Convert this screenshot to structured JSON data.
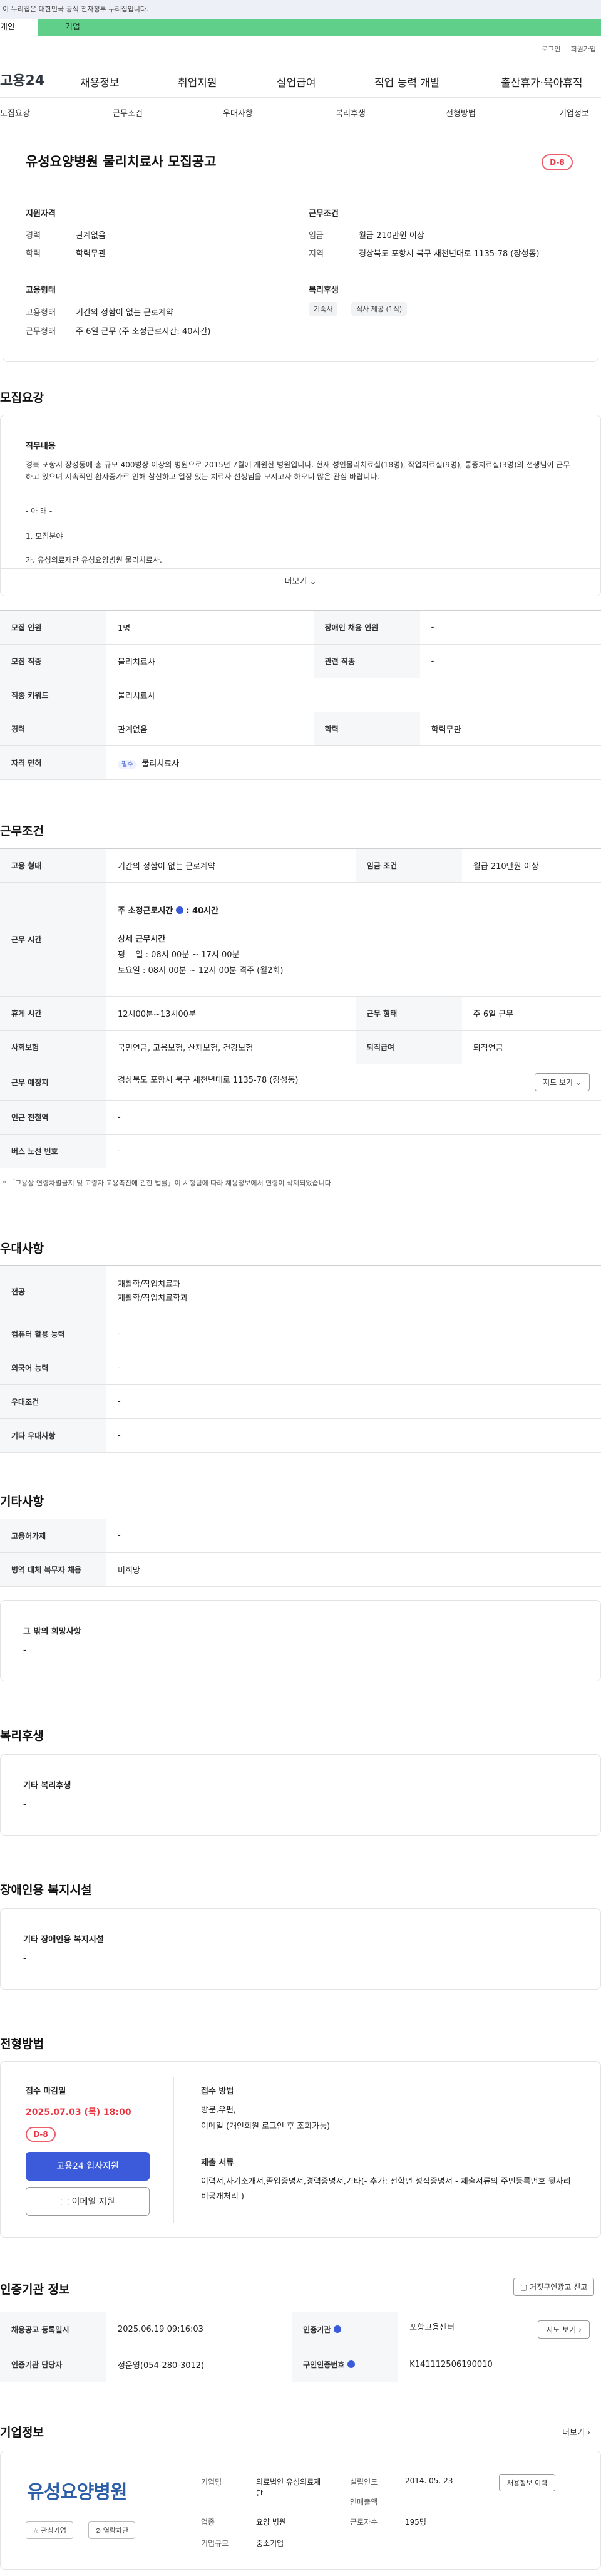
{
  "gov_banner": "이 누리집은 대한민국 공식 전자정부 누리집입니다.",
  "top_tabs": [
    "개인",
    "기업"
  ],
  "util": [
    "로그인",
    "회원가입"
  ],
  "logo": "고용24",
  "gnb": [
    "채용정보",
    "취업지원",
    "실업급여",
    "직업 능력 개발",
    "출산휴가·육아휴직"
  ],
  "snb": [
    "모집요강",
    "근무조건",
    "우대사항",
    "복리후생",
    "전형방법",
    "기업정보"
  ],
  "title": "유성요양병원 물리치료사 모집공고",
  "dday": "D-8",
  "summary": {
    "qual_h": "지원자격",
    "cond_h": "근무조건",
    "emp_h": "고용형태",
    "welfare_h": "복리후생",
    "career_l": "경력",
    "career_v": "관계없음",
    "edu_l": "학력",
    "edu_v": "학력무관",
    "wage_l": "임금",
    "wage_v": "월급 210만원 이상",
    "area_l": "지역",
    "area_v": "경상북도 포항시 북구 새천년대로 1135-78 (장성동)",
    "type_l": "고용형태",
    "type_v": "기간의 정함이 없는 근로계약",
    "work_l": "근무형태",
    "work_v": "주 6일 근무 (주 소정근로시간: 40시간)",
    "chips": [
      "기숙사",
      "식사 제공 (1식)"
    ]
  },
  "recruit": {
    "h": "모집요강",
    "job_h": "직무내용",
    "desc": "경북 포항시 장성동에 총 규모 400병상 이상의 병원으로 2015년 7월에 개원한 병원입니다. 현재 성인물리치료실(18명), 작업치료실(9명), 통증치료실(3명)의 선생님이 근무하고 있으며 지속적인 환자증가로 인해 참신하고 열정 있는 치료사 선생님을 모시고자 하오니 많은 관심 바랍니다.",
    "l1": "- 아 래 -",
    "l2": "1. 모집분야",
    "l3": "가. 유성의료재단 유성요양병원 물리치료사.",
    "more": "더보기",
    "rows": [
      [
        "모집 인원",
        "1명",
        "장애인 채용 인원",
        "-"
      ],
      [
        "모집 직종",
        "물리치료사",
        "관련 직종",
        "-"
      ],
      [
        "직종 키워드",
        "물리치료사"
      ],
      [
        "경력",
        "관계없음",
        "학력",
        "학력무관"
      ],
      [
        "자격 면허",
        "필수",
        "물리치료사"
      ]
    ]
  },
  "cond": {
    "h": "근무조건",
    "r1": [
      "고용 형태",
      "기간의 정함이 없는 근로계약",
      "임금 조건",
      "월급 210만원 이상"
    ],
    "time_l": "근무 시간",
    "time_b": "주 소정근로시간",
    "time_b2": ": 40시간",
    "detail_h": "상세 근무시간",
    "d1": "평    일 : 08시 00분 ~ 17시 00분",
    "d2": "토요일 : 08시 00분 ~ 12시 00분 격주 (월2회)",
    "r3": [
      "휴게 시간",
      "12시00분~13시00분",
      "근무 형태",
      "주 6일 근무"
    ],
    "r4": [
      "사회보험",
      "국민연금, 고용보험, 산재보험, 건강보험",
      "퇴직급여",
      "퇴직연금"
    ],
    "r5": [
      "근무 예정지",
      "경상북도 포항시 북구 새천년대로 1135-78 (장성동)",
      "지도 보기"
    ],
    "r6": [
      "인근 전철역",
      "-"
    ],
    "r7": [
      "버스 노선 번호",
      "-"
    ],
    "note": "* 「고용상 연령차별금지 및 고령자 고용촉진에 관한 법률」이 시행됨에 따라 채용정보에서 연령이 삭제되었습니다."
  },
  "pref": {
    "h": "우대사항",
    "rows": [
      [
        "전공",
        "재활학/작업치료과\n재활학/작업치료학과"
      ],
      [
        "컴퓨터 활용 능력",
        "-"
      ],
      [
        "외국어 능력",
        "-"
      ],
      [
        "우대조건",
        "-"
      ],
      [
        "기타 우대사항",
        "-"
      ]
    ]
  },
  "etc": {
    "h": "기타사항",
    "rows": [
      [
        "고용허가제",
        "-"
      ],
      [
        "병역 대체 복무자 채용",
        "비희망"
      ]
    ],
    "box_h": "그 밖의 희망사항",
    "box_v": "-"
  },
  "welfare": {
    "h": "복리후생",
    "box_h": "기타 복리후생",
    "box_v": "-"
  },
  "disabled": {
    "h": "장애인용 복지시설",
    "box_h": "기타 장애인용 복지시설",
    "box_v": "-"
  },
  "apply": {
    "h": "전형방법",
    "deadline_l": "접수 마감일",
    "deadline_v": "2025.07.03 (목) 18:00",
    "dday": "D-8",
    "btn1": "고용24 입사지원",
    "btn2": "이메일 지원",
    "method_h": "접수 방법",
    "method_v1": "방문,우편,",
    "method_v2": "이메일 (개인회원 로그인 후 조회가능)",
    "docs_h": "제출 서류",
    "docs_v": "이력서,자기소개서,졸업증명서,경력증명서,기타(- 추가: 전학년 성적증명서 - 제출서류의 주민등록번호 뒷자리 비공개처리 )"
  },
  "agency": {
    "h": "인증기관 정보",
    "report": "거짓구인광고 신고",
    "r1": [
      "채용공고 등록일시",
      "2025.06.19 09:16:03",
      "인증기관",
      "포항고용센터",
      "지도 보기"
    ],
    "r2": [
      "인증기관 담당자",
      "정운영(054-280-3012)",
      "구인인증번호",
      "K141112506190010"
    ]
  },
  "company": {
    "h": "기업정보",
    "more": "더보기",
    "logo": "유성요양병원",
    "fav": "관심기업",
    "block": "열람차단",
    "f": [
      [
        "기업명",
        "의료법인 유성의료재단"
      ],
      [
        "업종",
        "요양 병원"
      ],
      [
        "기업규모",
        "중소기업"
      ]
    ],
    "g": [
      [
        "설립연도",
        "2014. 05. 23"
      ],
      [
        "연매출액",
        "-"
      ],
      [
        "근로자수",
        "195명"
      ]
    ],
    "hist": "채용정보 이력"
  }
}
